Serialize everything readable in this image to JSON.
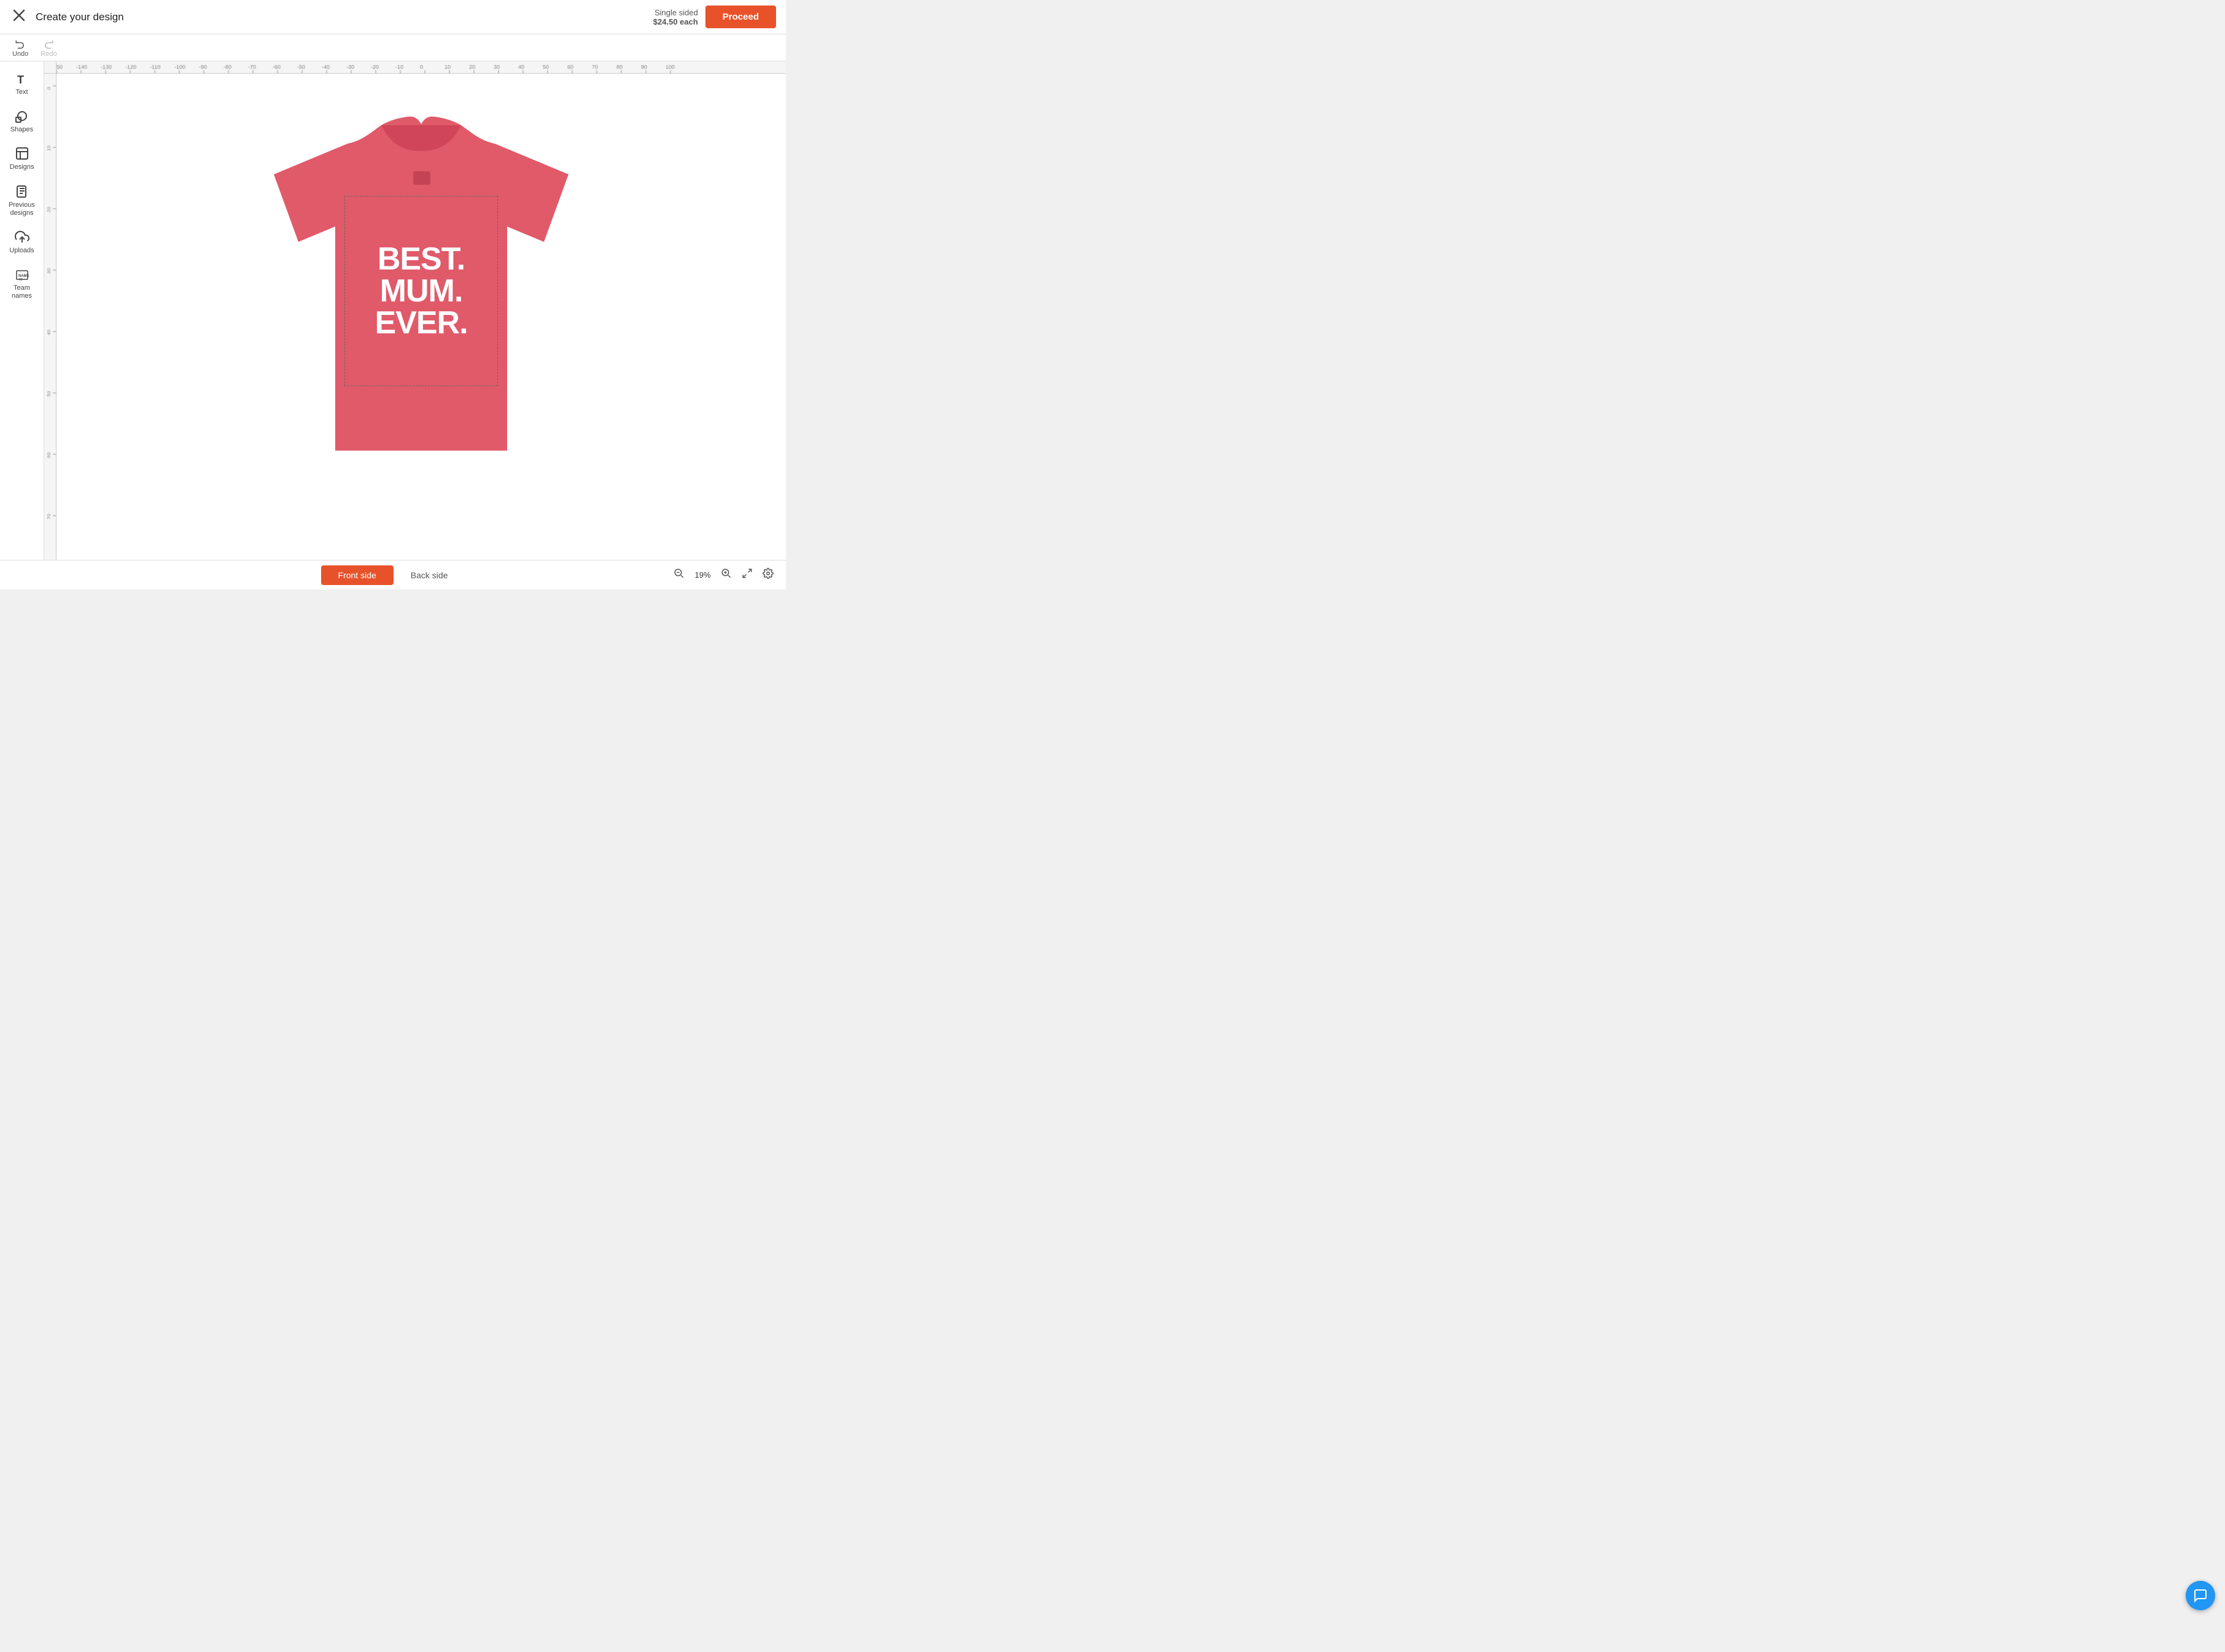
{
  "header": {
    "close_label": "×",
    "title": "Create your design",
    "pricing": {
      "label": "Single sided",
      "price": "$24.50 each"
    },
    "proceed_label": "Proceed"
  },
  "toolbar": {
    "undo_label": "Undo",
    "redo_label": "Redo"
  },
  "sidebar": {
    "items": [
      {
        "id": "text",
        "label": "Text",
        "icon": "text-icon"
      },
      {
        "id": "shapes",
        "label": "Shapes",
        "icon": "shapes-icon"
      },
      {
        "id": "designs",
        "label": "Designs",
        "icon": "designs-icon"
      },
      {
        "id": "previous-designs",
        "label": "Previous designs",
        "icon": "previous-designs-icon"
      },
      {
        "id": "uploads",
        "label": "Uploads",
        "icon": "uploads-icon"
      },
      {
        "id": "team-names",
        "label": "Team names",
        "icon": "team-names-icon"
      }
    ]
  },
  "canvas": {
    "design_text": "BEST.\nMUM.\nEVER.",
    "tshirt_color": "#e05a6a",
    "zoom_percent": "19%"
  },
  "bottom_bar": {
    "front_side_label": "Front side",
    "back_side_label": "Back side",
    "zoom_value": "19%"
  }
}
